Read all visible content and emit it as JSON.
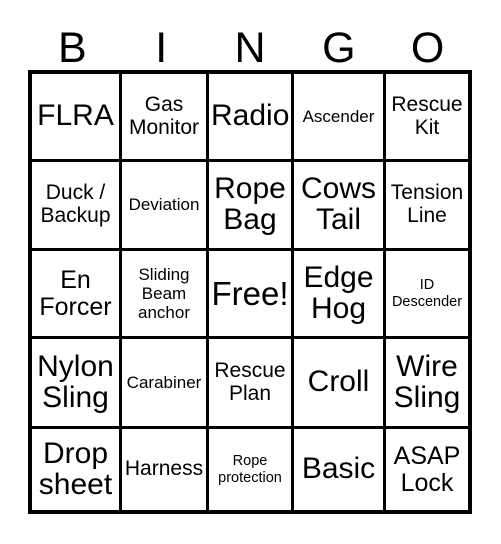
{
  "card": {
    "type": "bingo-card",
    "grid_size": "5x5",
    "header_letters": [
      "B",
      "I",
      "N",
      "G",
      "O"
    ],
    "colors": {
      "background": "#ffffff",
      "border": "#000000",
      "text": "#000000"
    },
    "rows": [
      [
        {
          "label": "FLRA",
          "size": "lg"
        },
        {
          "label": "Gas\nMonitor",
          "size": "sm"
        },
        {
          "label": "Radio",
          "size": "lg"
        },
        {
          "label": "Ascender",
          "size": "xs"
        },
        {
          "label": "Rescue\nKit",
          "size": "sm"
        }
      ],
      [
        {
          "label": "Duck /\nBackup",
          "size": "sm"
        },
        {
          "label": "Deviation",
          "size": "xs"
        },
        {
          "label": "Rope\nBag",
          "size": "lg"
        },
        {
          "label": "Cows\nTail",
          "size": "lg"
        },
        {
          "label": "Tension\nLine",
          "size": "sm"
        }
      ],
      [
        {
          "label": "En\nForcer",
          "size": "md"
        },
        {
          "label": "Sliding\nBeam\nanchor",
          "size": "xs"
        },
        {
          "label": "Free!",
          "size": "xl"
        },
        {
          "label": "Edge\nHog",
          "size": "lg"
        },
        {
          "label": "ID\nDescender",
          "size": "xxs"
        }
      ],
      [
        {
          "label": "Nylon\nSling",
          "size": "lg"
        },
        {
          "label": "Carabiner",
          "size": "xs"
        },
        {
          "label": "Rescue\nPlan",
          "size": "sm"
        },
        {
          "label": "Croll",
          "size": "lg"
        },
        {
          "label": "Wire\nSling",
          "size": "lg"
        }
      ],
      [
        {
          "label": "Drop\nsheet",
          "size": "lg"
        },
        {
          "label": "Harness",
          "size": "sm"
        },
        {
          "label": "Rope\nprotection",
          "size": "xxs"
        },
        {
          "label": "Basic",
          "size": "lg"
        },
        {
          "label": "ASAP\nLock",
          "size": "md"
        }
      ]
    ]
  }
}
